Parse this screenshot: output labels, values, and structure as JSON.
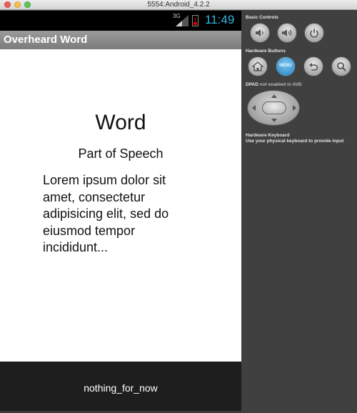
{
  "window": {
    "title": "5554:Android_4.2.2"
  },
  "status_bar": {
    "network": "3G",
    "time": "11:49",
    "battery_alert": "!"
  },
  "app": {
    "title": "Overheard Word",
    "word": "Word",
    "part_of_speech": "Part of Speech",
    "definition_lines": [
      "Lorem ipsum dolor sit",
      "amet, consectetur",
      "adipisicing elit, sed do",
      "eiusmod tempor",
      "incididunt..."
    ],
    "bottom_text": "nothing_for_now"
  },
  "controls": {
    "basic_label": "Basic Controls",
    "hardware_buttons_label": "Hardware Buttons",
    "menu_label": "MENU",
    "dpad_label": "DPAD",
    "dpad_note": "not enabled in AVD",
    "keyboard_label": "Hardware Keyboard",
    "keyboard_note": "Use your physical keyboard to provide input"
  },
  "colors": {
    "clock": "#33b5e5",
    "menu_button": "#3e97d1",
    "battery_low": "#d40000"
  }
}
